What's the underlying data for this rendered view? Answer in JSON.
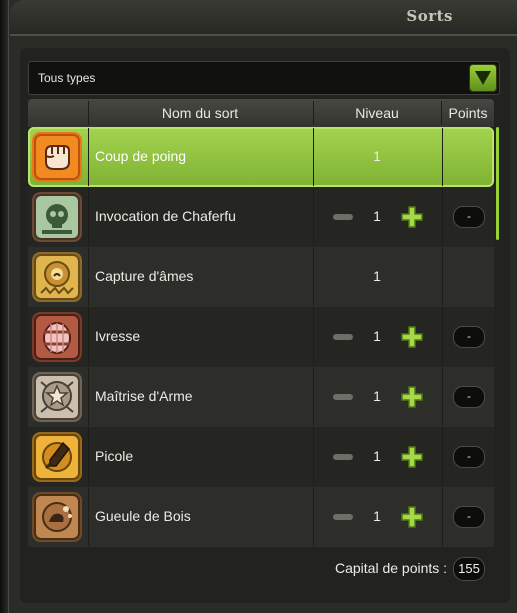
{
  "window": {
    "title": "Sorts"
  },
  "filter": {
    "selected": "Tous types"
  },
  "table": {
    "headers": {
      "name": "Nom du sort",
      "level": "Niveau",
      "points": "Points"
    },
    "rows": [
      {
        "name": "Coup de poing",
        "level": "1",
        "points": "",
        "icon": "fist-icon",
        "has_controls": false,
        "selected": true
      },
      {
        "name": "Invocation de Chaferfu",
        "level": "1",
        "points": "-",
        "icon": "skull-icon",
        "has_controls": true,
        "selected": false
      },
      {
        "name": "Capture d'âmes",
        "level": "1",
        "points": "",
        "icon": "soul-gear-icon",
        "has_controls": false,
        "selected": false
      },
      {
        "name": "Ivresse",
        "level": "1",
        "points": "-",
        "icon": "barrel-icon",
        "has_controls": true,
        "selected": false
      },
      {
        "name": "Maîtrise d'Arme",
        "level": "1",
        "points": "-",
        "icon": "star-burst-icon",
        "has_controls": true,
        "selected": false
      },
      {
        "name": "Picole",
        "level": "1",
        "points": "-",
        "icon": "bottle-icon",
        "has_controls": true,
        "selected": false
      },
      {
        "name": "Gueule de Bois",
        "level": "1",
        "points": "-",
        "icon": "breath-icon",
        "has_controls": true,
        "selected": false
      }
    ]
  },
  "footer": {
    "capital_label": "Capital de points :",
    "capital_value": "155"
  },
  "colors": {
    "accent": "#9ad03a",
    "selected_row": "#8fc23e"
  }
}
